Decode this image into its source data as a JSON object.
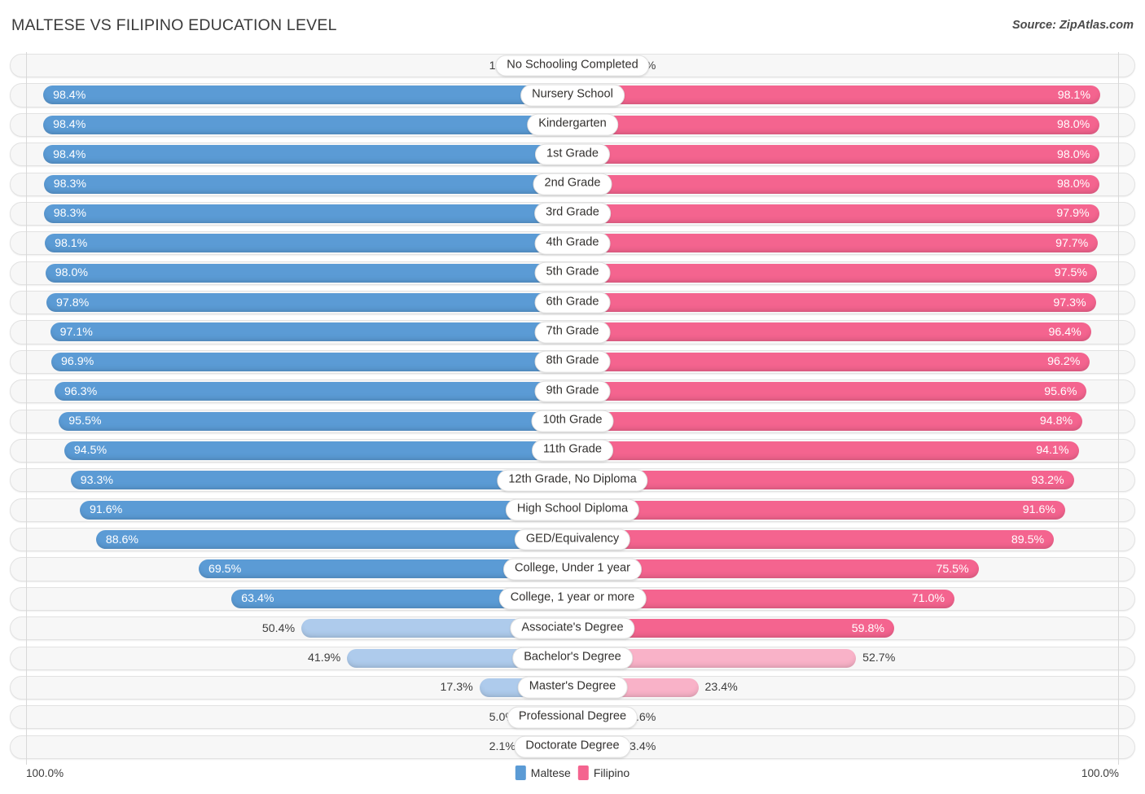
{
  "header": {
    "title": "MALTESE VS FILIPINO EDUCATION LEVEL",
    "source": "Source: ZipAtlas.com"
  },
  "legend": {
    "items": [
      {
        "label": "Maltese",
        "color": "#5b9bd5"
      },
      {
        "label": "Filipino",
        "color": "#f4648f"
      }
    ]
  },
  "footer": {
    "left_axis_max": "100.0%",
    "right_axis_max": "100.0%"
  },
  "colors": {
    "maltese_strong": "#5b9bd5",
    "maltese_light": "#aecbec",
    "filipino_strong": "#f4648f",
    "filipino_light": "#f9b2c8",
    "track_bg": "#f7f7f7",
    "track_border": "#e2e2e2",
    "axis": "#d8d8d8"
  },
  "chart_data": {
    "type": "bar",
    "subtype": "diverging-paired-bar",
    "title": "MALTESE VS FILIPINO EDUCATION LEVEL",
    "xlabel": "",
    "ylabel": "",
    "xlim": [
      0,
      100
    ],
    "unit": "%",
    "grid": false,
    "legend_position": "bottom-center",
    "categories": [
      "No Schooling Completed",
      "Nursery School",
      "Kindergarten",
      "1st Grade",
      "2nd Grade",
      "3rd Grade",
      "4th Grade",
      "5th Grade",
      "6th Grade",
      "7th Grade",
      "8th Grade",
      "9th Grade",
      "10th Grade",
      "11th Grade",
      "12th Grade, No Diploma",
      "High School Diploma",
      "GED/Equivalency",
      "College, Under 1 year",
      "College, 1 year or more",
      "Associate's Degree",
      "Bachelor's Degree",
      "Master's Degree",
      "Professional Degree",
      "Doctorate Degree"
    ],
    "series": [
      {
        "name": "Maltese",
        "side": "left",
        "color": "#5b9bd5",
        "values": [
          1.6,
          98.4,
          98.4,
          98.4,
          98.3,
          98.3,
          98.1,
          98.0,
          97.8,
          97.1,
          96.9,
          96.3,
          95.5,
          94.5,
          93.3,
          91.6,
          88.6,
          69.5,
          63.4,
          50.4,
          41.9,
          17.3,
          5.0,
          2.1
        ],
        "labels": [
          "1.6%",
          "98.4%",
          "98.4%",
          "98.4%",
          "98.3%",
          "98.3%",
          "98.1%",
          "98.0%",
          "97.8%",
          "97.1%",
          "96.9%",
          "96.3%",
          "95.5%",
          "94.5%",
          "93.3%",
          "91.6%",
          "88.6%",
          "69.5%",
          "63.4%",
          "50.4%",
          "41.9%",
          "17.3%",
          "5.0%",
          "2.1%"
        ]
      },
      {
        "name": "Filipino",
        "side": "right",
        "color": "#f4648f",
        "values": [
          2.0,
          98.1,
          98.0,
          98.0,
          98.0,
          97.9,
          97.7,
          97.5,
          97.3,
          96.4,
          96.2,
          95.6,
          94.8,
          94.1,
          93.2,
          91.6,
          89.5,
          75.5,
          71.0,
          59.8,
          52.7,
          23.4,
          7.6,
          3.4
        ],
        "labels": [
          "2.0%",
          "98.1%",
          "98.0%",
          "98.0%",
          "98.0%",
          "97.9%",
          "97.7%",
          "97.5%",
          "97.3%",
          "96.4%",
          "96.2%",
          "95.6%",
          "94.8%",
          "94.1%",
          "93.2%",
          "91.6%",
          "89.5%",
          "75.5%",
          "71.0%",
          "59.8%",
          "52.7%",
          "23.4%",
          "7.6%",
          "3.4%"
        ]
      }
    ]
  }
}
